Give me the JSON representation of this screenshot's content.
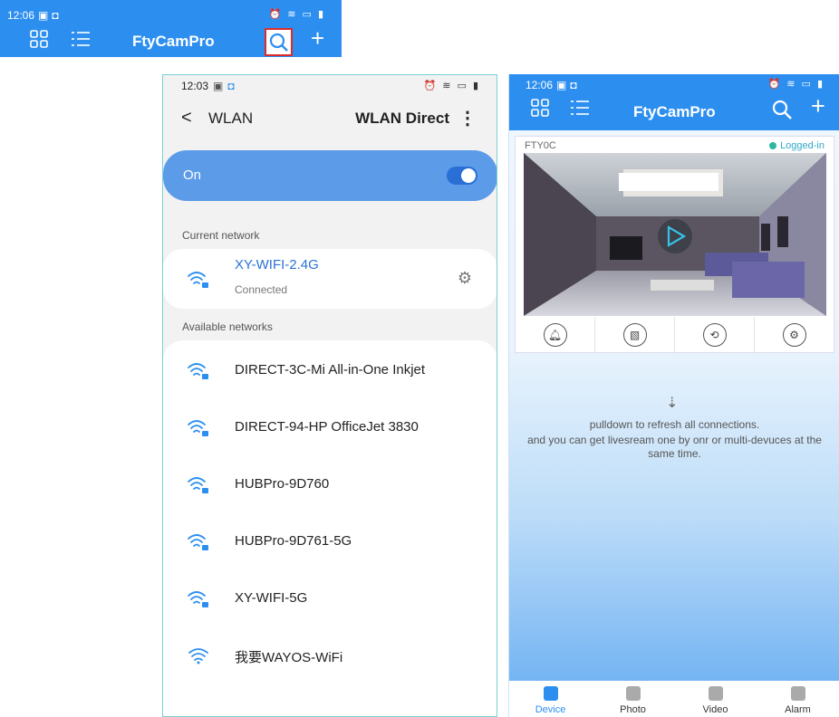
{
  "top_bar": {
    "time": "12:06",
    "title": "FtyCamPro",
    "highlight_color": "#e02a2a"
  },
  "wlan": {
    "time": "12:03",
    "back_icon": "chevron-left",
    "title": "WLAN",
    "direct_label": "WLAN Direct",
    "more_icon": "vertical-dots",
    "toggle_label": "On",
    "toggle_on": true,
    "current_section": "Current network",
    "current": {
      "name": "XY-WIFI-2.4G",
      "status": "Connected"
    },
    "available_section": "Available networks",
    "networks": [
      {
        "name": "DIRECT-3C-Mi All-in-One Inkjet",
        "secured": true
      },
      {
        "name": "DIRECT-94-HP OfficeJet 3830",
        "secured": true
      },
      {
        "name": "HUBPro-9D760",
        "secured": true
      },
      {
        "name": "HUBPro-9D761-5G",
        "secured": true
      },
      {
        "name": "XY-WIFI-5G",
        "secured": true
      },
      {
        "name": "我要WAYOS-WiFi",
        "secured": false
      }
    ]
  },
  "cam": {
    "time": "12:06",
    "title": "FtyCamPro",
    "device": {
      "name": "FTY0C",
      "status": "Logged-in"
    },
    "action_icons": [
      "bell-icon",
      "image-icon",
      "replay-icon",
      "gear-icon"
    ],
    "hint_line1": "pulldown to refresh all connections.",
    "hint_line2": "and you can get livesream one by onr or multi-devuces at the",
    "hint_line3": "same time.",
    "tabs": [
      {
        "label": "Device",
        "active": true
      },
      {
        "label": "Photo",
        "active": false
      },
      {
        "label": "Video",
        "active": false
      },
      {
        "label": "Alarm",
        "active": false
      }
    ]
  },
  "colors": {
    "brand_blue": "#2c8ff0",
    "toggle_card": "#5b9be8",
    "connected_text": "#2a73d6",
    "online_dot": "#2cb8a0"
  }
}
